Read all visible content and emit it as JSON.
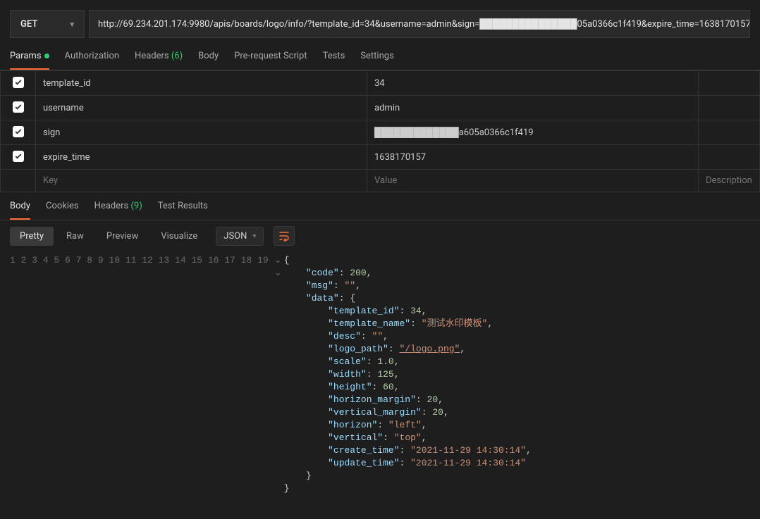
{
  "request": {
    "method": "GET",
    "url": "http://69.234.201.174:9980/apis/boards/logo/info/?template_id=34&username=admin&sign=███████████████05a0366c1f419&expire_time=1638170157"
  },
  "req_tabs": {
    "params": "Params",
    "authorization": "Authorization",
    "headers": "Headers",
    "headers_count": "(6)",
    "body": "Body",
    "prerequest": "Pre-request Script",
    "tests": "Tests",
    "settings": "Settings"
  },
  "params": [
    {
      "key": "template_id",
      "value": "34"
    },
    {
      "key": "username",
      "value": "admin"
    },
    {
      "key": "sign",
      "value": "█████████████a605a0366c1f419"
    },
    {
      "key": "expire_time",
      "value": "1638170157"
    }
  ],
  "params_placeholder": {
    "key": "Key",
    "value": "Value",
    "desc": "Description"
  },
  "resp_tabs": {
    "body": "Body",
    "cookies": "Cookies",
    "headers": "Headers",
    "headers_count": "(9)",
    "test_results": "Test Results"
  },
  "viewmodes": {
    "pretty": "Pretty",
    "raw": "Raw",
    "preview": "Preview",
    "visualize": "Visualize"
  },
  "format": "JSON",
  "lines": [
    "1",
    "2",
    "3",
    "4",
    "5",
    "6",
    "7",
    "8",
    "9",
    "10",
    "11",
    "12",
    "13",
    "14",
    "15",
    "16",
    "17",
    "18",
    "19"
  ],
  "response_body": {
    "code": 200,
    "msg": "",
    "data": {
      "template_id": 34,
      "template_name": "测试水印模板",
      "desc": "",
      "logo_path": "/logo.png",
      "scale": 1.0,
      "width": 125,
      "height": 60,
      "horizon_margin": 20,
      "vertical_margin": 20,
      "horizon": "left",
      "vertical": "top",
      "create_time": "2021-11-29 14:30:14",
      "update_time": "2021-11-29 14:30:14"
    }
  }
}
